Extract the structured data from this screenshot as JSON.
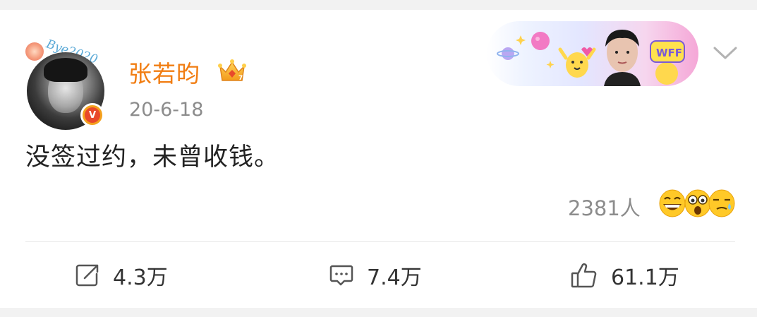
{
  "post": {
    "author_name": "张若昀",
    "avatar_sticker_text": "Bye2020",
    "verified_badge": "V",
    "date": "20-6-18",
    "content": "没签过约，未曾收钱。",
    "banner_tag": "WFF"
  },
  "reactions": {
    "count_label": "2381人",
    "emojis": [
      "grinning-face",
      "astonished-face",
      "sleepy-face"
    ]
  },
  "actions": {
    "share_count": "4.3万",
    "comment_count": "7.4万",
    "like_count": "61.1万"
  },
  "colors": {
    "username": "#f17d12",
    "secondary_text": "#8c8c8c",
    "body_text": "#222222",
    "background": "#f2f2f2"
  },
  "icons": [
    "share-icon",
    "comment-icon",
    "like-icon",
    "chevron-down-icon",
    "crown-icon"
  ]
}
